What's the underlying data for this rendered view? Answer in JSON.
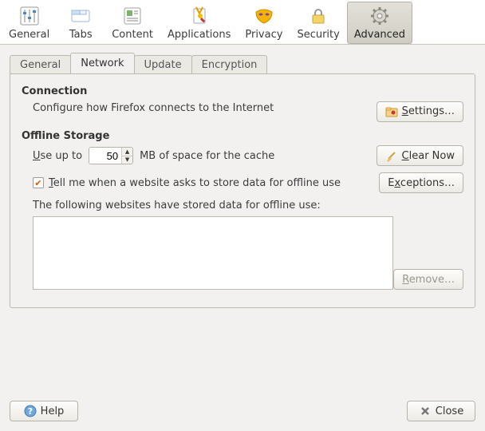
{
  "toolbar": {
    "items": [
      {
        "label": "General"
      },
      {
        "label": "Tabs"
      },
      {
        "label": "Content"
      },
      {
        "label": "Applications"
      },
      {
        "label": "Privacy"
      },
      {
        "label": "Security"
      },
      {
        "label": "Advanced"
      }
    ],
    "selected": "Advanced"
  },
  "subtabs": {
    "items": [
      {
        "label": "General"
      },
      {
        "label": "Network"
      },
      {
        "label": "Update"
      },
      {
        "label": "Encryption"
      }
    ],
    "active": "Network"
  },
  "connection": {
    "title": "Connection",
    "desc": "Configure how Firefox connects to the Internet",
    "settings_label": "Settings…"
  },
  "offline": {
    "title": "Offline Storage",
    "use_prefix": "Use up to",
    "cache_mb": "50",
    "use_suffix": "MB of space for the cache",
    "clear_label": "Clear Now",
    "tell_checked": true,
    "tell_label": "Tell me when a website asks to store data for offline use",
    "exceptions_label": "Exceptions…",
    "list_label": "The following websites have stored data for offline use:",
    "remove_label": "Remove…"
  },
  "footer": {
    "help": "Help",
    "close": "Close"
  }
}
